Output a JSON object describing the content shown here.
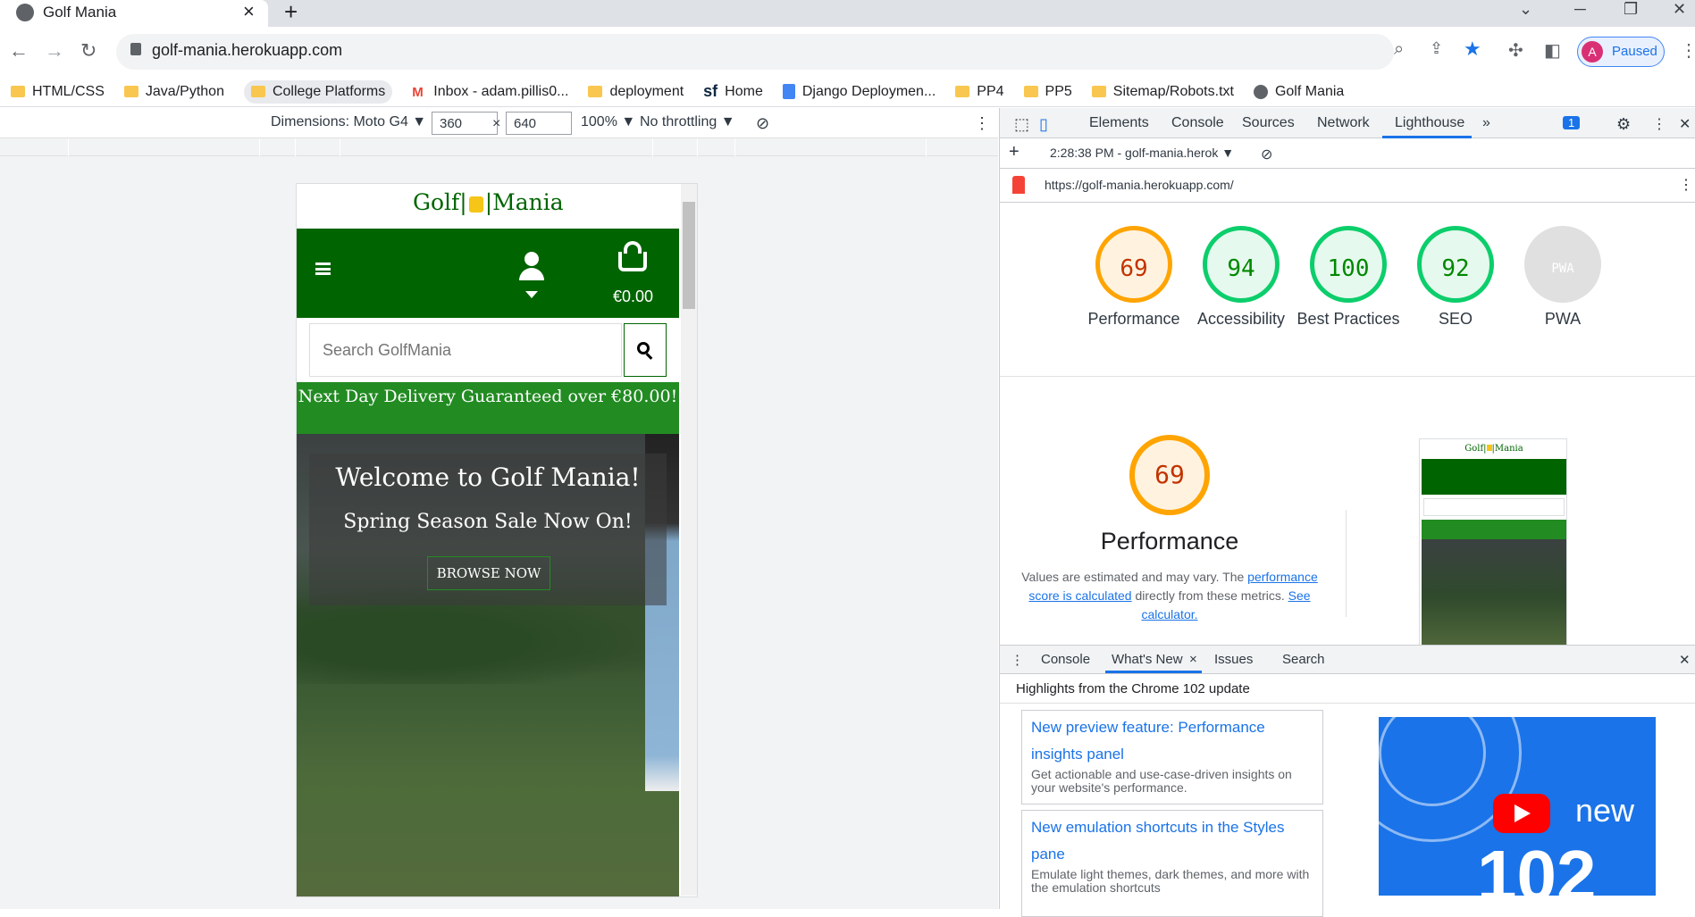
{
  "browser": {
    "tab_title": "Golf Mania",
    "url": "golf-mania.herokuapp.com",
    "profile_initial": "A",
    "profile_status": "Paused",
    "bookmarks": [
      "HTML/CSS",
      "Java/Python",
      "College Platforms",
      "Inbox - adam.pillis0...",
      "deployment",
      "Home",
      "Django Deploymen...",
      "PP4",
      "PP5",
      "Sitemap/Robots.txt",
      "Golf Mania"
    ]
  },
  "device_toolbar": {
    "dimensions": "Dimensions: Moto G4 ▼",
    "width": "360",
    "times": "×",
    "height": "640",
    "zoom": "100% ▼",
    "throttle": "No throttling ▼"
  },
  "site": {
    "logo_left": "Golf|",
    "logo_right": "|Mania",
    "cart_total": "€0.00",
    "search_placeholder": "Search GolfMania",
    "promo": "Next Day Delivery Guaranteed over €80.00!",
    "hero_title": "Welcome to Golf Mania!",
    "hero_subtitle": "Spring Season Sale Now On!",
    "browse_button": "BROWSE NOW"
  },
  "devtools": {
    "tabs": [
      "Elements",
      "Console",
      "Sources",
      "Network",
      "Lighthouse"
    ],
    "more": "»",
    "issue_count": "1",
    "report_label": "2:28:38 PM - golf-mania.herok ▼",
    "report_url": "https://golf-mania.herokuapp.com/",
    "scores": [
      {
        "value": "69",
        "label": "Performance"
      },
      {
        "value": "94",
        "label": "Accessibility"
      },
      {
        "value": "100",
        "label": "Best Practices"
      },
      {
        "value": "92",
        "label": "SEO"
      },
      {
        "value": "PWA",
        "label": "PWA"
      }
    ],
    "perf_score": "69",
    "perf_title": "Performance",
    "perf_desc_1": "Values are estimated and may vary. The",
    "perf_link_1": "performance score is calculated",
    "perf_desc_2": "directly from these metrics.",
    "perf_link_2": "See calculator.",
    "drawer_tabs": [
      "Console",
      "What's New",
      "Issues",
      "Search"
    ],
    "drawer_close": "×",
    "highlights": "Highlights from the Chrome 102 update",
    "cards": [
      {
        "title": "New preview feature: Performance insights panel",
        "desc": "Get actionable and use-case-driven insights on your website's performance."
      },
      {
        "title": "New emulation shortcuts in the Styles pane",
        "desc": "Emulate light themes, dark themes, and more with the emulation shortcuts"
      }
    ],
    "video_new": "new",
    "video_num": "102"
  }
}
